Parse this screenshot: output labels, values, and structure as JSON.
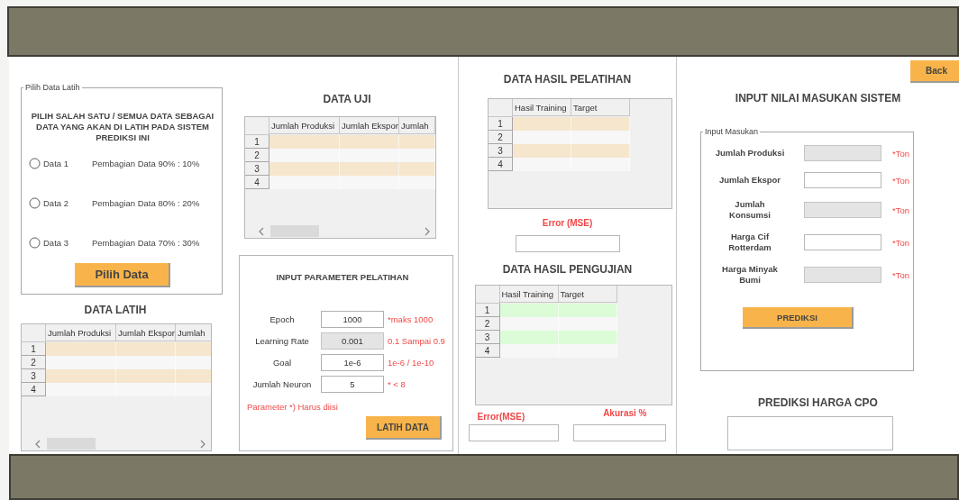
{
  "back_button": "Back",
  "data_selection": {
    "legend": "Pilih Data Latih",
    "instruction": "PILIH SALAH SATU / SEMUA DATA SEBAGAI DATA YANG AKAN DI LATIH PADA SISTEM PREDIKSI INI",
    "options": [
      {
        "label": "Data 1",
        "description": "Pembagian Data 90% : 10%",
        "selected": false
      },
      {
        "label": "Data 2",
        "description": "Pembagian Data 80% : 20%",
        "selected": false
      },
      {
        "label": "Data 3",
        "description": "Pembagian Data 70% : 30%",
        "selected": false
      }
    ],
    "button": "Pilih Data"
  },
  "training_data": {
    "title": "DATA LATIH",
    "columns": [
      "Jumlah Produksi",
      "Jumlah Ekspor",
      "Jumlah"
    ],
    "row_numbers": [
      "1",
      "2",
      "3",
      "4"
    ]
  },
  "test_data": {
    "title": "DATA UJI",
    "columns": [
      "Jumlah Produksi",
      "Jumlah Ekspor",
      "Jumlah"
    ],
    "row_numbers": [
      "1",
      "2",
      "3",
      "4"
    ]
  },
  "training_parameters": {
    "title": "INPUT PARAMETER PELATIHAN",
    "fields": [
      {
        "label": "Epoch",
        "value": "1000",
        "hint": "*maks 1000",
        "disabled": false
      },
      {
        "label": "Learning Rate",
        "value": "0.001",
        "hint": "0.1 Sampai 0.9",
        "disabled": true
      },
      {
        "label": "Goal",
        "value": "1e-6",
        "hint": "1e-6 / 1e-10",
        "disabled": false
      },
      {
        "label": "Jumlah Neuron",
        "value": "5",
        "hint": "* < 8",
        "disabled": false
      }
    ],
    "note": "Parameter *) Harus diisi",
    "button": "LATIH DATA"
  },
  "training_results": {
    "title": "DATA HASIL PELATIHAN",
    "columns": [
      "Hasil Training",
      "Target"
    ],
    "row_numbers": [
      "1",
      "2",
      "3",
      "4"
    ],
    "error_label": "Error (MSE)"
  },
  "testing_results": {
    "title": "DATA HASIL PENGUJIAN",
    "columns": [
      "Hasil Training",
      "Target"
    ],
    "row_numbers": [
      "1",
      "2",
      "3",
      "4"
    ],
    "error_label": "Error(MSE)",
    "accuracy_label": "Akurasi %"
  },
  "system_input": {
    "title": "INPUT NILAI MASUKAN SISTEM",
    "legend": "Input Masukan",
    "fields": [
      {
        "label": "Jumlah Produksi",
        "unit": "*Ton",
        "disabled": true
      },
      {
        "label": "Jumlah Ekspor",
        "unit": "*Ton",
        "disabled": false
      },
      {
        "label": "Jumlah Konsumsi",
        "unit": "*Ton",
        "disabled": true
      },
      {
        "label": "Harga Cif Rotterdam",
        "unit": "*Ton",
        "disabled": false
      },
      {
        "label": "Harga Minyak Bumi",
        "unit": "*Ton",
        "disabled": true
      }
    ],
    "button": "PREDIKSI"
  },
  "prediction": {
    "title": "PREDIKSI HARGA CPO"
  }
}
